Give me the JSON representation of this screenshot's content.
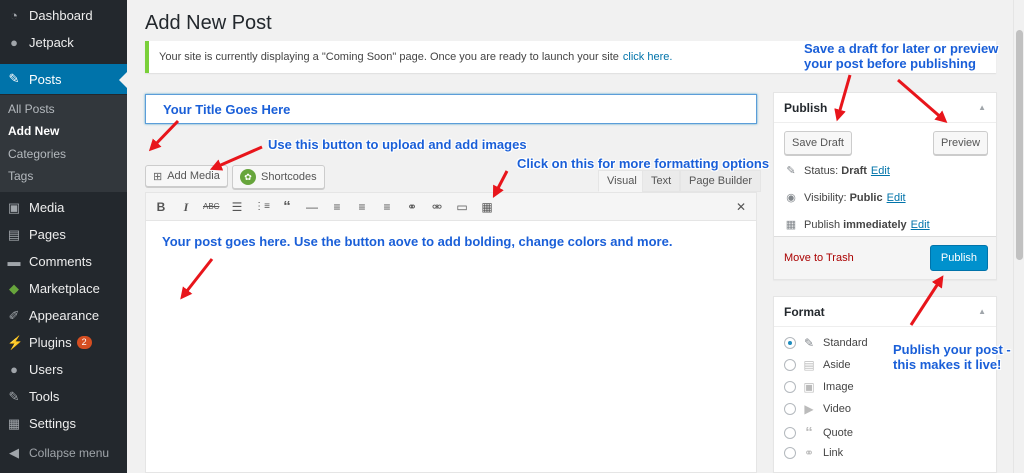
{
  "sidebar": {
    "items": [
      {
        "label": "Dashboard",
        "icon": "dashboard-icon"
      },
      {
        "label": "Jetpack",
        "icon": "jetpack-icon"
      },
      {
        "label": "Posts",
        "icon": "pin-icon"
      },
      {
        "label": "Media",
        "icon": "media-icon"
      },
      {
        "label": "Pages",
        "icon": "pages-icon"
      },
      {
        "label": "Comments",
        "icon": "comments-icon"
      },
      {
        "label": "Marketplace",
        "icon": "marketplace-icon"
      },
      {
        "label": "Appearance",
        "icon": "appearance-icon"
      },
      {
        "label": "Plugins",
        "icon": "plugins-icon",
        "badge": "2"
      },
      {
        "label": "Users",
        "icon": "users-icon"
      },
      {
        "label": "Tools",
        "icon": "tools-icon"
      },
      {
        "label": "Settings",
        "icon": "settings-icon"
      }
    ],
    "submenu": [
      "All Posts",
      "Add New",
      "Categories",
      "Tags"
    ],
    "collapse": "Collapse menu"
  },
  "page_title": "Add New Post",
  "notice": {
    "text": "Your site is currently displaying a \"Coming Soon\" page. Once you are ready to launch your site",
    "link": "click here."
  },
  "editor": {
    "add_media": "Add Media",
    "shortcodes": "Shortcodes",
    "tabs": [
      "Visual",
      "Text",
      "Page Builder"
    ],
    "toolbar_icons": [
      "bold-icon",
      "italic-icon",
      "strikethrough-icon",
      "bullet-list-icon",
      "numbered-list-icon",
      "blockquote-icon",
      "horizontal-rule-icon",
      "align-left-icon",
      "align-center-icon",
      "align-right-icon",
      "link-icon",
      "unlink-icon",
      "read-more-icon",
      "toolbar-toggle-icon",
      "fullscreen-icon"
    ]
  },
  "publish": {
    "title": "Publish",
    "save_draft": "Save Draft",
    "preview": "Preview",
    "status_label": "Status:",
    "status_value": "Draft",
    "visibility_label": "Visibility:",
    "visibility_value": "Public",
    "publish_label": "Publish",
    "publish_value": "immediately",
    "edit": "Edit",
    "trash": "Move to Trash",
    "publish_button": "Publish"
  },
  "format": {
    "title": "Format",
    "options": [
      "Standard",
      "Aside",
      "Image",
      "Video",
      "Quote",
      "Link"
    ],
    "selected": "Standard"
  },
  "annotations": {
    "title": "Your Title Goes Here",
    "upload": "Use this button to upload and add images",
    "formatting": "Click on this for more formatting options",
    "draft_line1": "Save a draft for later or preview",
    "draft_line2": "your post before publishing",
    "post": "Your post goes here. Use the button aove to add bolding, change colors and more.",
    "publish_line1": "Publish your post -",
    "publish_line2": "this makes it live!"
  },
  "colors": {
    "sidebar_bg": "#23282d",
    "active_menu": "#0073aa",
    "publish_button": "#0091cd",
    "annotation_text": "#1a5fd8",
    "arrow": "#e8151b",
    "notice_border": "#7ad03a"
  }
}
